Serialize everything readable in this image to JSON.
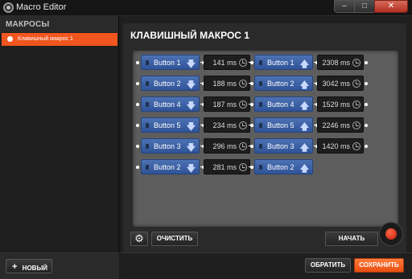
{
  "window": {
    "title": "Macro Editor",
    "min": "–",
    "max": "□",
    "close": "✕"
  },
  "sidebar": {
    "header": "МАКРОСЫ",
    "items": [
      {
        "label": "Клавишный макрос 1",
        "selected": true
      }
    ],
    "new_button": {
      "icon": "+",
      "label": "НОВЫЙ"
    }
  },
  "editor": {
    "title": "КЛАВИШНЫЙ МАКРОС 1",
    "rows": [
      {
        "down_key": "Button 1",
        "down_delay": "141 ms",
        "up_key": "Button 1",
        "up_delay": "2308 ms"
      },
      {
        "down_key": "Button 2",
        "down_delay": "188 ms",
        "up_key": "Button 2",
        "up_delay": "3042 ms"
      },
      {
        "down_key": "Button 4",
        "down_delay": "187 ms",
        "up_key": "Button 4",
        "up_delay": "1529 ms"
      },
      {
        "down_key": "Button 5",
        "down_delay": "234 ms",
        "up_key": "Button 5",
        "up_delay": "2246 ms"
      },
      {
        "down_key": "Button 3",
        "down_delay": "296 ms",
        "up_key": "Button 3",
        "up_delay": "1420 ms"
      },
      {
        "down_key": "Button 2",
        "down_delay": "281 ms",
        "up_key": "Button 2",
        "up_delay": ""
      }
    ],
    "arrows": {
      "down": "🡇",
      "up": "🡅"
    },
    "settings_icon": "⚙",
    "clear_label": "ОЧИСТИТЬ",
    "start_label": "НАЧАТЬ"
  },
  "footer": {
    "cancel_label": "ОБРАТИТЬ",
    "save_label": "СОХРАНИТЬ"
  },
  "colors": {
    "accent": "#f0561e",
    "key_node": "#3d63a8",
    "delay_node": "#1e1e1e",
    "record": "#d42a10"
  }
}
